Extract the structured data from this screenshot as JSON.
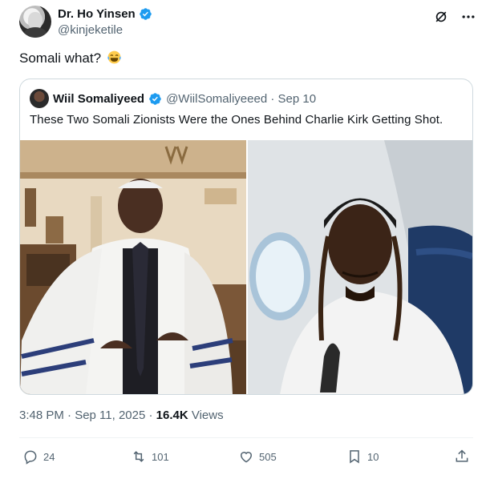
{
  "author": {
    "display_name": "Dr. Ho Yinsen",
    "handle": "@kinjeketile"
  },
  "tweet_text": "Somali what?",
  "quoted": {
    "display_name": "Wiil Somaliyeed",
    "handle_date": "@WiilSomaliyeeed · Sep 10",
    "text": "These Two Somali Zionists Were the Ones Behind Charlie Kirk Getting Shot."
  },
  "meta": {
    "timestamp": "3:48 PM · Sep 11, 2025 · ",
    "views_count": "16.4K",
    "views_label": " Views"
  },
  "actions": {
    "replies": "24",
    "retweets": "101",
    "likes": "505",
    "bookmarks": "10"
  },
  "colors": {
    "verified": "#1d9bf0",
    "muted": "#536471",
    "border": "#cfd9de"
  },
  "icons": [
    "verified-icon",
    "grok-icon",
    "more-icon",
    "laughing-emoji-icon",
    "reply-icon",
    "retweet-icon",
    "like-icon",
    "bookmark-icon",
    "share-icon"
  ]
}
